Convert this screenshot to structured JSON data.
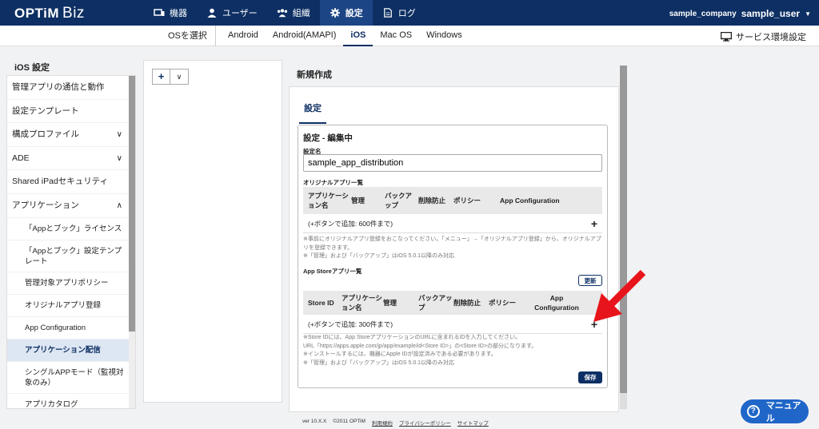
{
  "header": {
    "brand": "OPTiM",
    "brand_suffix": "Biz",
    "nav": [
      {
        "label": "機器",
        "icon": "device-icon"
      },
      {
        "label": "ユーザー",
        "icon": "user-icon"
      },
      {
        "label": "組織",
        "icon": "group-icon"
      },
      {
        "label": "設定",
        "icon": "gear-icon",
        "active": true
      },
      {
        "label": "ログ",
        "icon": "log-icon"
      }
    ],
    "company": "sample_company",
    "user": "sample_user"
  },
  "osbar": {
    "select_label": "OSを選択",
    "tabs": [
      "Android",
      "Android(AMAPI)",
      "iOS",
      "Mac OS",
      "Windows"
    ],
    "active_tab": "iOS",
    "service_settings": "サービス環境設定"
  },
  "sidebar": {
    "title": "iOS 設定",
    "items": [
      {
        "label": "管理アプリの通信と動作"
      },
      {
        "label": "設定テンプレート"
      },
      {
        "label": "構成プロファイル",
        "chevron": "∨"
      },
      {
        "label": "ADE",
        "chevron": "∨"
      },
      {
        "label": "Shared iPadセキュリティ"
      },
      {
        "label": "アプリケーション",
        "chevron": "∧"
      },
      {
        "label": "「Appとブック」ライセンス",
        "sub": true
      },
      {
        "label": "「Appとブック」設定テンプレート",
        "sub": true,
        "two": true
      },
      {
        "label": "管理対象アプリポリシー",
        "sub": true
      },
      {
        "label": "オリジナルアプリ登録",
        "sub": true
      },
      {
        "label": "App Configuration",
        "sub": true
      },
      {
        "label": "アプリケーション配信",
        "sub": true,
        "active": true
      },
      {
        "label": "シングルAPPモード（監視対象のみ）",
        "sub": true,
        "two": true
      },
      {
        "label": "アプリカタログ",
        "sub": true
      }
    ]
  },
  "main": {
    "title": "新規作成",
    "tab": "設定",
    "section_title": "設定 - 編集中",
    "name_label": "設定名",
    "name_value": "sample_app_distribution",
    "original_label": "オリジナルアプリ一覧",
    "original_cols": [
      "アプリケーション名",
      "管理",
      "バックアップ",
      "削除防止",
      "ポリシー",
      "App Configuration"
    ],
    "original_add_text": "(+ボタンで追加: 600件まで)",
    "original_note": "※事前にオリジナルアプリ登録をおこなってください。「メニュー」→「オリジナルアプリ登録」から、オリジナルアプリを登録できます。\n※「管理」および「バックアップ」はiOS 5.0.1以降のみ対応",
    "appstore_label": "App Storeアプリ一覧",
    "refresh_button": "更新",
    "appstore_cols": [
      "Store ID",
      "アプリケーション名",
      "管理",
      "バックアップ",
      "削除防止",
      "ポリシー",
      "App Configuration"
    ],
    "appstore_add_text": "(+ボタンで追加: 300件まで)",
    "appstore_note": "※Store IDには、App StoreアプリケーションのURLに含まれるIDを入力してください。\nURL「https://apps.apple.com/jp/app/example/id<Store ID>」の<Store ID>の部分になります。\n※インストールするには、機器にApple IDが設定済みである必要があります。\n※「管理」および「バックアップ」はiOS 5.0.1以降のみ対応",
    "save_button": "保存"
  },
  "footer": {
    "version": "ver 10.X.X",
    "copyright": "©2011 OPTiM",
    "links": [
      "利用規約",
      "プライバシーポリシー",
      "サイトマップ"
    ]
  },
  "manual_button": "マニュアル",
  "colors": {
    "header": "#0d2f63",
    "accent": "#1f66c8",
    "arrow": "#e8141b"
  }
}
